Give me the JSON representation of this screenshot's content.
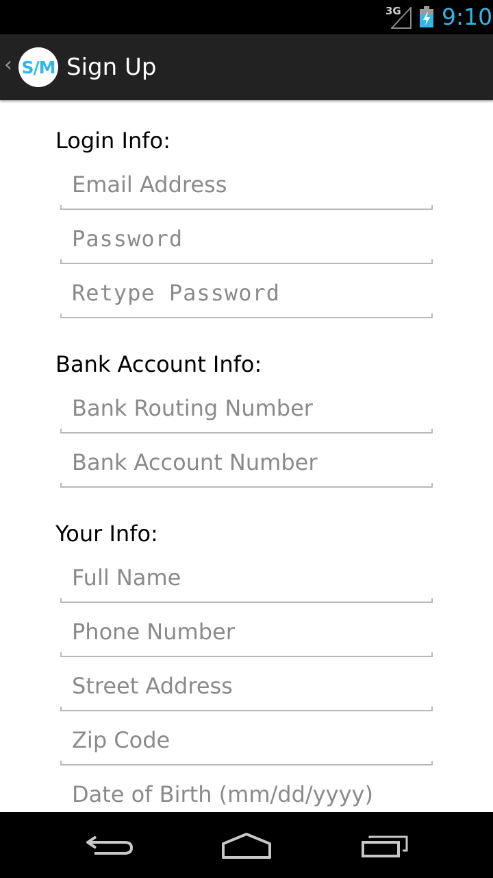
{
  "status_bar": {
    "network": "3G",
    "time": "9:10",
    "signal_icon": "cell-signal-icon",
    "battery_icon": "battery-charging-icon"
  },
  "action_bar": {
    "logo_text": "S/M",
    "title": "Sign Up",
    "up_icon": "back-caret-icon"
  },
  "form": {
    "login": {
      "label": "Login Info:",
      "email_placeholder": "Email Address",
      "password_placeholder": "Password",
      "retype_password_placeholder": "Retype Password"
    },
    "bank": {
      "label": "Bank Account Info:",
      "routing_placeholder": "Bank Routing Number",
      "account_placeholder": "Bank Account Number"
    },
    "personal": {
      "label": "Your Info:",
      "full_name_placeholder": "Full Name",
      "phone_placeholder": "Phone Number",
      "street_placeholder": "Street Address",
      "zip_placeholder": "Zip Code",
      "dob_placeholder": "Date of Birth (mm/dd/yyyy)"
    }
  },
  "nav_bar": {
    "back_icon": "back-arrow-icon",
    "home_icon": "home-icon",
    "recents_icon": "recent-apps-icon"
  },
  "colors": {
    "accent": "#33b5e5",
    "action_bar": "#222222",
    "hint_text": "#8a8a8a",
    "underline": "#b8b8b8"
  }
}
